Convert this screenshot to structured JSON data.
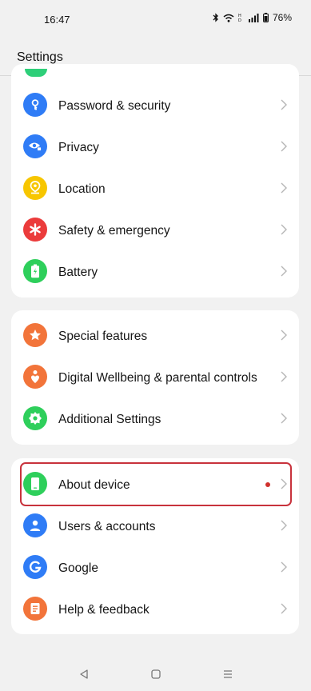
{
  "status_bar": {
    "time": "16:47",
    "battery": "76%",
    "icons": [
      "bluetooth-icon",
      "wifi-icon",
      "hd-icon",
      "signal-icon",
      "battery-icon"
    ]
  },
  "header": {
    "title": "Settings"
  },
  "groups": [
    {
      "items": [
        {
          "label": "Password & security",
          "icon": "key-icon",
          "color": "#2f7cf6"
        },
        {
          "label": "Privacy",
          "icon": "eye-lock-icon",
          "color": "#2f7cf6"
        },
        {
          "label": "Location",
          "icon": "location-pin-icon",
          "color": "#f7c600"
        },
        {
          "label": "Safety & emergency",
          "icon": "asterisk-icon",
          "color": "#eb3b3b"
        },
        {
          "label": "Battery",
          "icon": "battery-icon",
          "color": "#2ecf5b"
        }
      ]
    },
    {
      "items": [
        {
          "label": "Special features",
          "icon": "star-icon",
          "color": "#f2743a"
        },
        {
          "label": "Digital Wellbeing & parental controls",
          "icon": "wellbeing-icon",
          "color": "#f2743a"
        },
        {
          "label": "Additional Settings",
          "icon": "gear-icon",
          "color": "#2ecf5b"
        }
      ]
    },
    {
      "items": [
        {
          "label": "About device",
          "icon": "phone-icon",
          "color": "#2ecf5b",
          "has_dot": true,
          "highlighted": true
        },
        {
          "label": "Users & accounts",
          "icon": "user-icon",
          "color": "#2f7cf6"
        },
        {
          "label": "Google",
          "icon": "google-icon",
          "color": "#2f7cf6"
        },
        {
          "label": "Help & feedback",
          "icon": "help-doc-icon",
          "color": "#f2743a"
        }
      ]
    }
  ],
  "nav_bar": {
    "buttons": [
      "back-icon",
      "home-icon",
      "recents-icon"
    ]
  }
}
